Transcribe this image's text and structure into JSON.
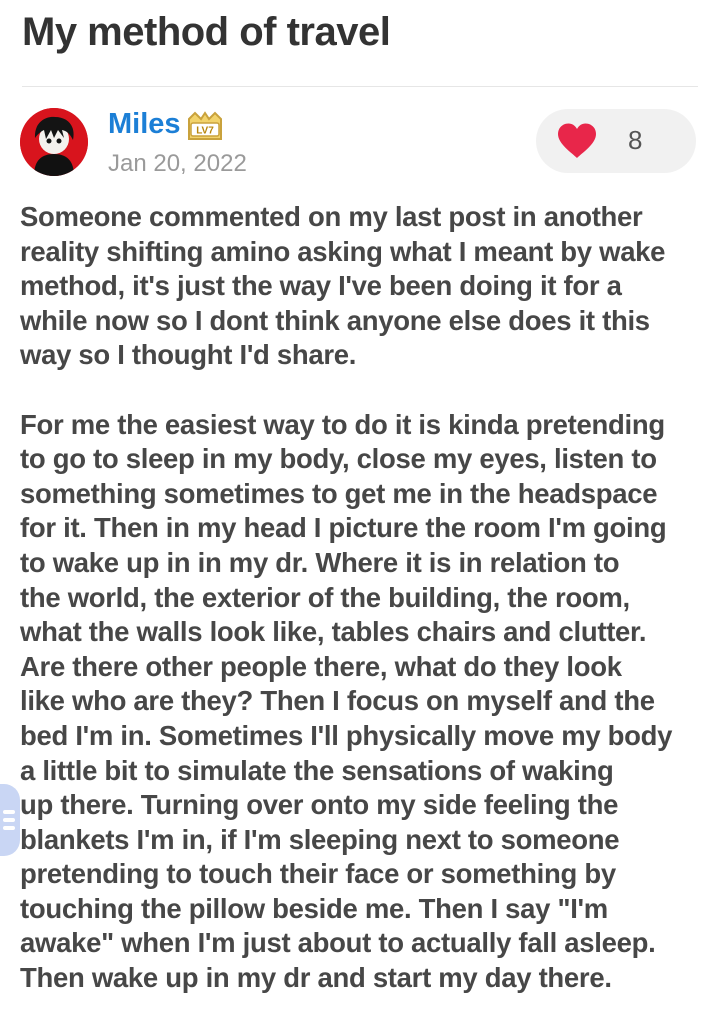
{
  "post": {
    "title": "My method of travel",
    "author": {
      "name": "Miles",
      "level_badge": "LV7",
      "date": "Jan 20, 2022"
    },
    "likes": {
      "count": "8",
      "icon": "heart-icon",
      "color": "#e8264a"
    },
    "paragraphs": [
      "Someone commented on my last post in another\nreality shifting amino asking what I meant by wake\nmethod, it's just the way I've been doing it for a\nwhile now so I dont think anyone else does it this\nway so I thought I'd share.",
      "For me the easiest way to do it is kinda pretending\nto go to sleep in my body, close my eyes, listen to\nsomething sometimes to get me in the headspace\nfor it. Then in my head I picture the room I'm going\nto wake up in in my dr. Where it is in relation to\nthe world, the exterior of the building, the room,\nwhat the walls look like, tables chairs and clutter.\nAre there other people there, what do they look\nlike who are they? Then I focus on myself and the\nbed I'm in. Sometimes I'll physically move my body\na little bit to simulate the sensations of waking\nup there. Turning over onto my side feeling the\nblankets I'm in, if I'm sleeping next to someone\npretending to touch their face or something by\ntouching the pillow beside me. Then I say \"I'm\nawake\" when I'm just about to actually fall asleep.\nThen wake up in my dr and start my day there."
    ]
  },
  "ui": {
    "author_color": "#1c7fd6",
    "side_tab_icon": "menu-lines-icon"
  }
}
